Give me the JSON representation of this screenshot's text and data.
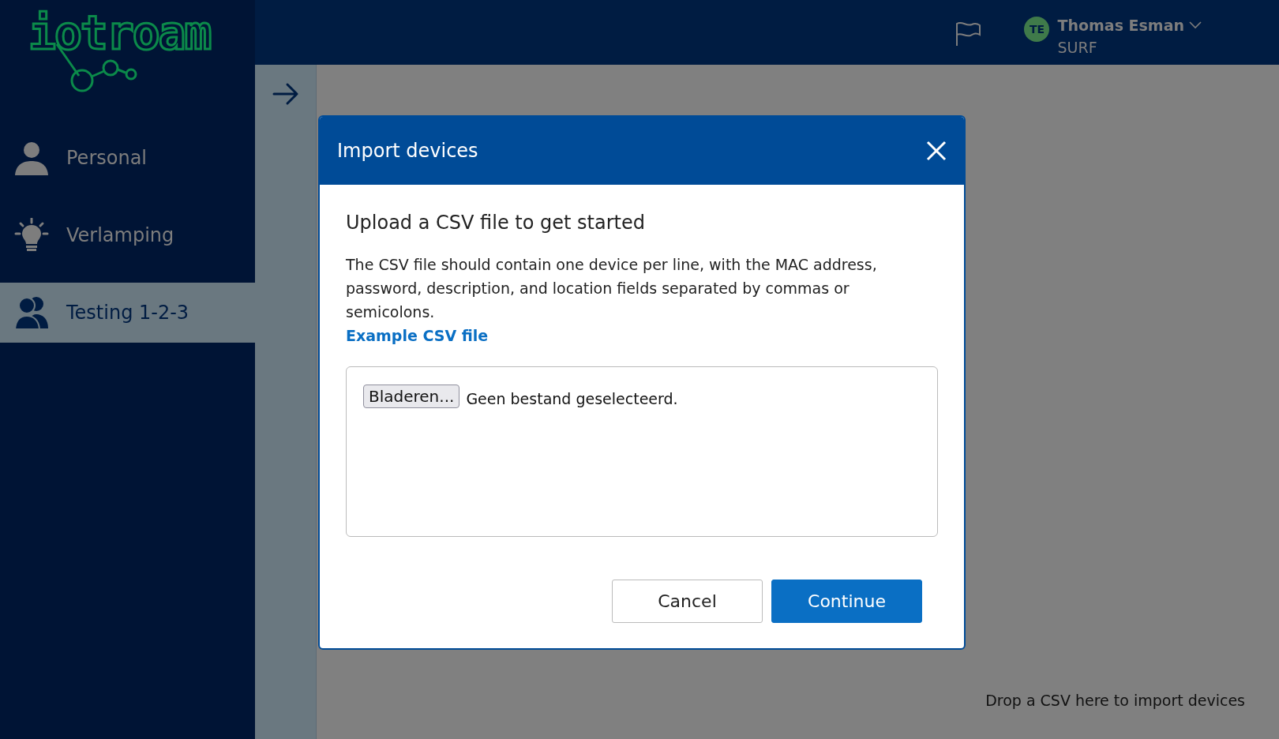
{
  "logo": {
    "text": "iotroam"
  },
  "sidebar": {
    "items": [
      {
        "label": "Personal",
        "selected": false
      },
      {
        "label": "Verlamping",
        "selected": false
      },
      {
        "label": "Testing 1-2-3",
        "selected": true
      }
    ]
  },
  "header": {
    "user": {
      "initials": "TE",
      "name": "Thomas Esman",
      "organization": "SURF"
    }
  },
  "dialog": {
    "title": "Import devices",
    "heading": "Upload a CSV file to get started",
    "description": "The CSV file should contain one device per line, with the MAC address, password, description, and location fields separated by commas or semicolons.",
    "link": "Example CSV file",
    "file_input": {
      "button": "Bladeren...",
      "status": "Geen bestand geselecteerd."
    },
    "buttons": [
      {
        "label": "Cancel",
        "kind": "secondary"
      },
      {
        "label": "Continue",
        "kind": "primary"
      }
    ]
  },
  "drop_hint": "Drop a CSV here to import devices"
}
